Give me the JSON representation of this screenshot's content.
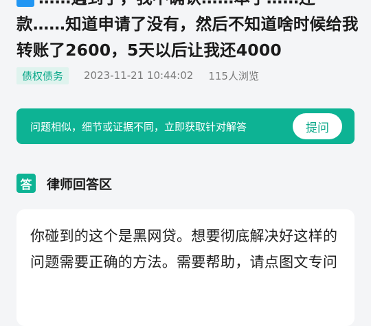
{
  "question": {
    "title": "……遇到了，我不确认……本子……还款……知道申请了没有，然后不知道啥时候给我转账了2600，5天以后让我还4000",
    "category_tag": "债权债务",
    "timestamp": "2023-11-21 10:44:02",
    "views": "115人浏览"
  },
  "banner": {
    "text": "问题相似，细节或证据不同，立即获取针对解答",
    "ask_button": "提问"
  },
  "answers_section": {
    "icon_label": "答",
    "title": "律师回答区"
  },
  "answer": {
    "text": "你碰到的这个是黑网贷。想要彻底解决好这样的问题需要正确的方法。需要帮助，请点图文专问"
  },
  "colors": {
    "accent": "#0db394",
    "tag_bg": "#dff3ee",
    "background": "#f4f5f7"
  }
}
